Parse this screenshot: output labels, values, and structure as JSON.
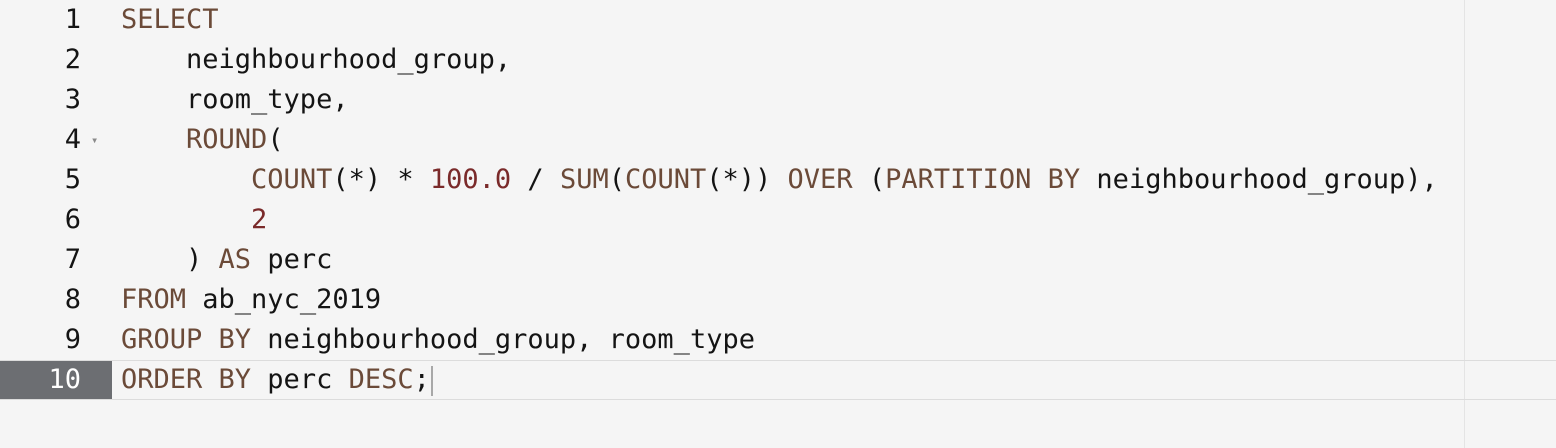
{
  "editor": {
    "language": "sql",
    "active_line": 10,
    "colors": {
      "keyword": "#6b4a38",
      "number": "#7a2a2a",
      "identifier": "#141414",
      "active_gutter": "#6c6e72",
      "background": "#f5f5f5"
    },
    "lines": [
      {
        "number": "1",
        "fold": "",
        "tokens": [
          {
            "t": "kw",
            "v": "SELECT"
          }
        ]
      },
      {
        "number": "2",
        "fold": "",
        "tokens": [
          {
            "t": "id",
            "v": "    neighbourhood_group,"
          }
        ]
      },
      {
        "number": "3",
        "fold": "",
        "tokens": [
          {
            "t": "id",
            "v": "    room_type,"
          }
        ]
      },
      {
        "number": "4",
        "fold": "▾",
        "tokens": [
          {
            "t": "id",
            "v": "    "
          },
          {
            "t": "kw",
            "v": "ROUND"
          },
          {
            "t": "punc",
            "v": "("
          }
        ]
      },
      {
        "number": "5",
        "fold": "",
        "tokens": [
          {
            "t": "id",
            "v": "        "
          },
          {
            "t": "kw",
            "v": "COUNT"
          },
          {
            "t": "punc",
            "v": "(*) * "
          },
          {
            "t": "num",
            "v": "100.0"
          },
          {
            "t": "punc",
            "v": " / "
          },
          {
            "t": "kw",
            "v": "SUM"
          },
          {
            "t": "punc",
            "v": "("
          },
          {
            "t": "kw",
            "v": "COUNT"
          },
          {
            "t": "punc",
            "v": "(*)) "
          },
          {
            "t": "kw",
            "v": "OVER"
          },
          {
            "t": "punc",
            "v": " ("
          },
          {
            "t": "kw",
            "v": "PARTITION BY"
          },
          {
            "t": "id",
            "v": " neighbourhood_group"
          },
          {
            "t": "punc",
            "v": "),"
          }
        ]
      },
      {
        "number": "6",
        "fold": "",
        "tokens": [
          {
            "t": "id",
            "v": "        "
          },
          {
            "t": "num",
            "v": "2"
          }
        ]
      },
      {
        "number": "7",
        "fold": "",
        "tokens": [
          {
            "t": "punc",
            "v": "    ) "
          },
          {
            "t": "kw",
            "v": "AS"
          },
          {
            "t": "id",
            "v": " perc"
          }
        ]
      },
      {
        "number": "8",
        "fold": "",
        "tokens": [
          {
            "t": "kw",
            "v": "FROM"
          },
          {
            "t": "id",
            "v": " ab_nyc_2019"
          }
        ]
      },
      {
        "number": "9",
        "fold": "",
        "tokens": [
          {
            "t": "kw",
            "v": "GROUP BY"
          },
          {
            "t": "id",
            "v": " neighbourhood_group, room_type"
          }
        ]
      },
      {
        "number": "10",
        "fold": "",
        "tokens": [
          {
            "t": "kw",
            "v": "ORDER BY"
          },
          {
            "t": "id",
            "v": " perc "
          },
          {
            "t": "kw",
            "v": "DESC"
          },
          {
            "t": "punc",
            "v": ";"
          }
        ]
      }
    ]
  }
}
